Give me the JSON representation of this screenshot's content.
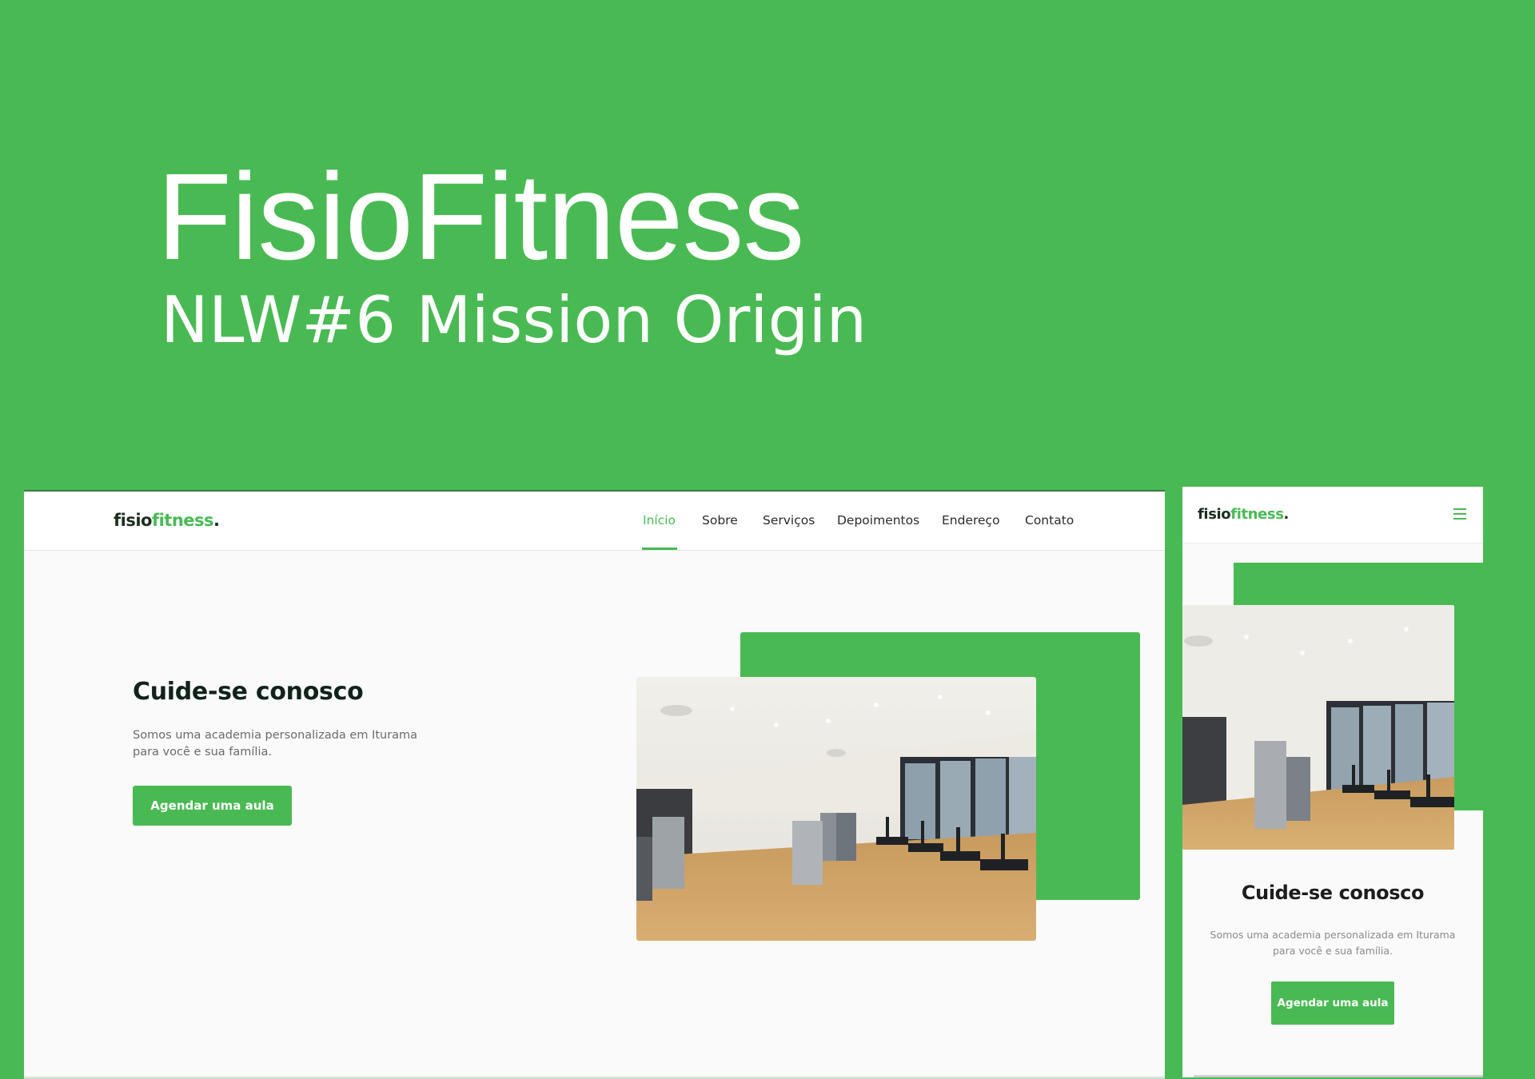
{
  "banner": {
    "title": "FisioFitness",
    "subtitle": "NLW#6 Mission Origin"
  },
  "site": {
    "logo": {
      "part1": "fisio",
      "part2": "fitness",
      "part3": "."
    },
    "nav": [
      "Início",
      "Sobre",
      "Serviços",
      "Depoimentos",
      "Endereço",
      "Contato"
    ],
    "active_nav": "Início",
    "hero": {
      "title": "Cuide-se conosco",
      "text": "Somos uma academia personalizada em Iturama para você e sua família.",
      "button_label": "Agendar uma aula",
      "image": "gym-interior-photo"
    }
  },
  "icons": {
    "mobile_menu": "hamburger-menu-icon"
  },
  "colors": {
    "brand_green": "#49ba53",
    "dark_text": "#10231a",
    "body_text": "#6b6b6b",
    "page_bg": "#fafafa"
  }
}
